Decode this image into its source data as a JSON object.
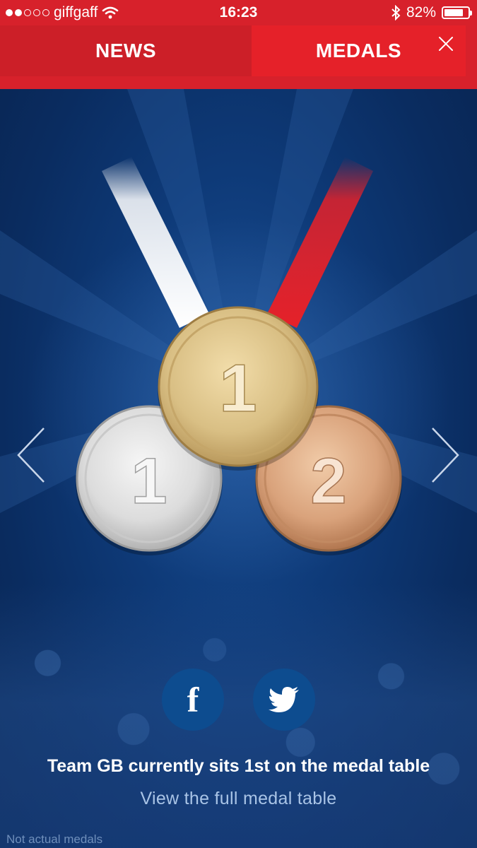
{
  "status_bar": {
    "carrier": "giffgaff",
    "signal_dots_filled": 2,
    "signal_dots_total": 5,
    "time": "16:23",
    "battery_percent": "82%",
    "battery_level": 0.82,
    "icons": [
      "wifi-icon",
      "bluetooth-icon",
      "battery-icon"
    ]
  },
  "tabs": [
    {
      "label": "NEWS",
      "selected": false
    },
    {
      "label": "MEDALS",
      "selected": true
    }
  ],
  "medals": {
    "gold": "1",
    "silver": "1",
    "bronze": "2"
  },
  "standing_text": "Team GB currently sits 1st on the medal table",
  "link_text": "View the full medal table",
  "disclaimer": "Not actual medals",
  "colors": {
    "header_red": "#d7212b",
    "background_blue": "#0b2f66",
    "social_button_blue": "#0d4c8f",
    "link_blue": "#a9c4e6"
  }
}
